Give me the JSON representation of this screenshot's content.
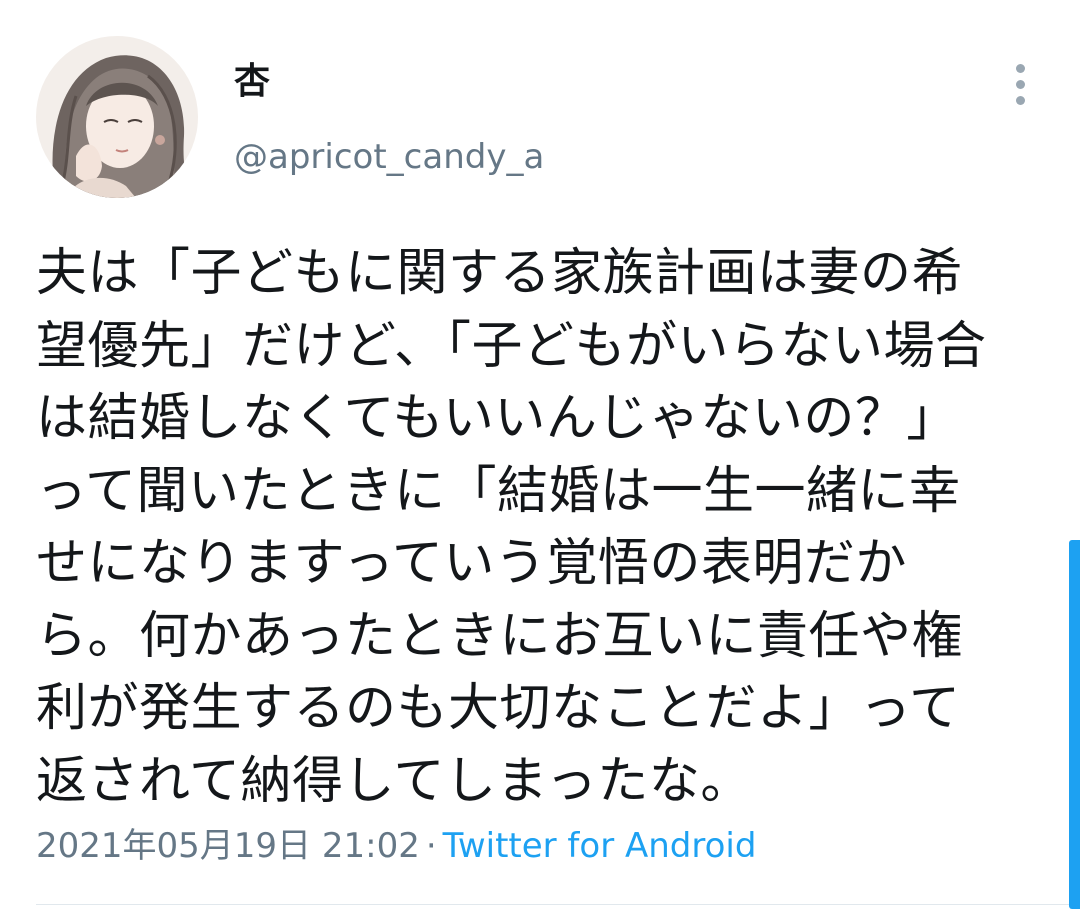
{
  "user": {
    "display_name": "杏",
    "handle": "@apricot_candy_a"
  },
  "tweet": {
    "lines": [
      "夫は「子どもに関する家族計画は妻の希",
      "望優先」だけど、「子どもがいらない場合",
      "は結婚しなくてもいいんじゃないの？」",
      "って聞いたときに「結婚は一生一緒に幸",
      "せになりますっていう覚悟の表明だか",
      "ら。何かあったときにお互いに責任や権",
      "利が発生するのも大切なことだよ」って",
      "返されて納得してしまったな。"
    ]
  },
  "meta": {
    "timestamp": "2021年05月19日 21:02",
    "separator": "·",
    "source": "Twitter for Android"
  },
  "icons": {
    "more": "more-vertical-icon"
  },
  "colors": {
    "text": "#14171a",
    "secondary": "#657786",
    "accent": "#1da1f2"
  }
}
